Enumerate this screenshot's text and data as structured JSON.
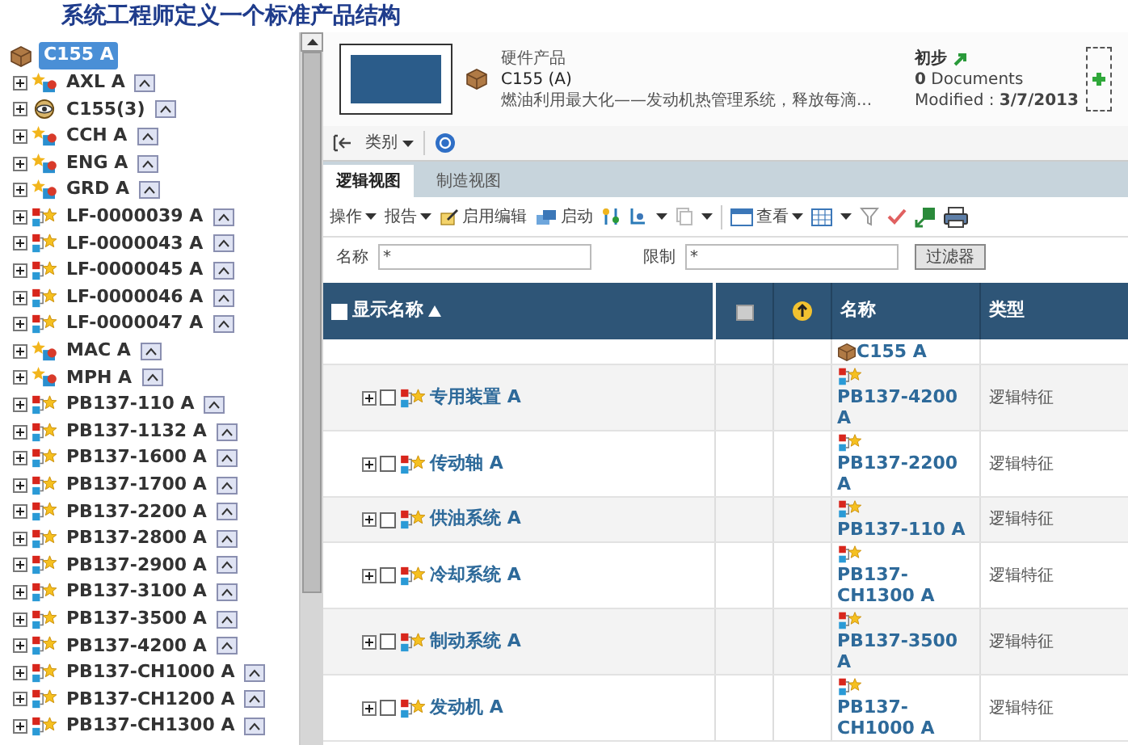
{
  "title": "系统工程师定义一个标准产品结构",
  "tree": {
    "label": "C155 A",
    "kind": "root",
    "selected": true,
    "children": [
      {
        "label": "AXL A",
        "kind": "feature"
      },
      {
        "label": "C155(3)",
        "kind": "config"
      },
      {
        "label": "CCH A",
        "kind": "feature"
      },
      {
        "label": "ENG A",
        "kind": "feature"
      },
      {
        "label": "GRD A",
        "kind": "feature"
      },
      {
        "label": "LF-0000039 A",
        "kind": "part"
      },
      {
        "label": "LF-0000043 A",
        "kind": "part"
      },
      {
        "label": "LF-0000045 A",
        "kind": "part"
      },
      {
        "label": "LF-0000046 A",
        "kind": "part"
      },
      {
        "label": "LF-0000047 A",
        "kind": "part"
      },
      {
        "label": "MAC A",
        "kind": "feature"
      },
      {
        "label": "MPH A",
        "kind": "feature"
      },
      {
        "label": "PB137-110 A",
        "kind": "part"
      },
      {
        "label": "PB137-1132 A",
        "kind": "part"
      },
      {
        "label": "PB137-1600 A",
        "kind": "part"
      },
      {
        "label": "PB137-1700 A",
        "kind": "part"
      },
      {
        "label": "PB137-2200 A",
        "kind": "part"
      },
      {
        "label": "PB137-2800 A",
        "kind": "part"
      },
      {
        "label": "PB137-2900 A",
        "kind": "part"
      },
      {
        "label": "PB137-3100 A",
        "kind": "part"
      },
      {
        "label": "PB137-3500 A",
        "kind": "part"
      },
      {
        "label": "PB137-4200 A",
        "kind": "part"
      },
      {
        "label": "PB137-CH1000 A",
        "kind": "part"
      },
      {
        "label": "PB137-CH1200 A",
        "kind": "part"
      },
      {
        "label": "PB137-CH1300 A",
        "kind": "part"
      }
    ]
  },
  "header": {
    "type": "硬件产品",
    "name": "C155 (A)",
    "description": "燃油利用最大化——发动机热管理系统，释放每滴...",
    "state": "初步",
    "documents_count": "0",
    "documents_label": "Documents",
    "modified_label": "Modified :",
    "modified_date": "3/7/2013"
  },
  "toolbar": {
    "category_menu": "类别"
  },
  "tabs": [
    {
      "label": "逻辑视图",
      "selected": true
    },
    {
      "label": "制造视图",
      "selected": false
    }
  ],
  "actions": {
    "operate": "操作",
    "report": "报告",
    "enable_edit": "启用编辑",
    "launch": "启动",
    "view": "查看"
  },
  "filter": {
    "name_label": "名称",
    "name_value": "*",
    "limit_label": "限制",
    "limit_value": "*",
    "button": "过滤器"
  },
  "table": {
    "select_all_checked": false,
    "columns": [
      "显示名称",
      "名称",
      "类型"
    ],
    "rows": [
      {
        "kind": "root",
        "display_name": "",
        "name": "C155 A",
        "type": ""
      },
      {
        "kind": "part",
        "display_name": "专用装置 A",
        "name": "PB137-4200 A",
        "type": "逻辑特征",
        "checked": false
      },
      {
        "kind": "part",
        "display_name": "传动轴 A",
        "name": "PB137-2200 A",
        "type": "逻辑特征",
        "checked": false
      },
      {
        "kind": "part",
        "display_name": "供油系统 A",
        "name": "PB137-110 A",
        "type": "逻辑特征",
        "checked": false
      },
      {
        "kind": "part",
        "display_name": "冷却系统 A",
        "name": "PB137-CH1300 A",
        "type": "逻辑特征",
        "checked": false
      },
      {
        "kind": "part",
        "display_name": "制动系统 A",
        "name": "PB137-3500 A",
        "type": "逻辑特征",
        "checked": false
      },
      {
        "kind": "part",
        "display_name": "发动机 A",
        "name": "PB137-CH1000 A",
        "type": "逻辑特征",
        "checked": false
      }
    ]
  }
}
